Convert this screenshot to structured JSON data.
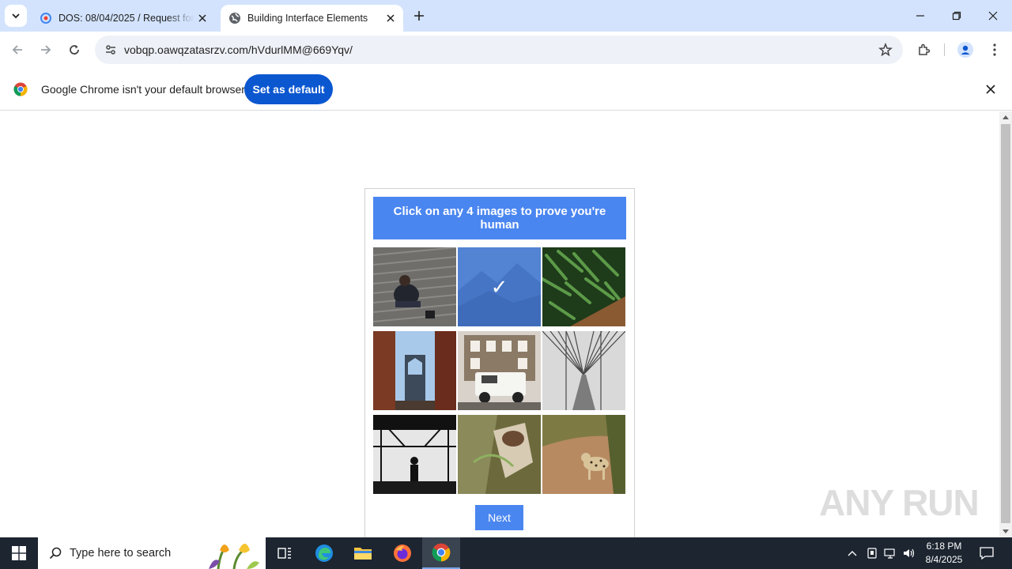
{
  "browser": {
    "tabs": [
      {
        "title": "DOS: 08/04/2025 / Request for",
        "active": false
      },
      {
        "title": "Building Interface Elements",
        "active": true
      }
    ],
    "url": "vobqp.oawqzatasrzv.com/hVdurlMM@669Yqv/"
  },
  "infobar": {
    "message": "Google Chrome isn't your default browser",
    "button_label": "Set as default"
  },
  "captcha": {
    "instruction": "Click on any 4 images to prove you're human",
    "selected_mark": "✓",
    "next_label": "Next",
    "tiles": [
      {
        "name": "person-sitting-on-steps",
        "selected": false
      },
      {
        "name": "mountain-landscape",
        "selected": true
      },
      {
        "name": "green-beans",
        "selected": false
      },
      {
        "name": "bridge-between-buildings",
        "selected": false
      },
      {
        "name": "white-suv-by-building",
        "selected": false
      },
      {
        "name": "suspension-bridge-walkway",
        "selected": false
      },
      {
        "name": "silhouette-under-structure",
        "selected": false
      },
      {
        "name": "person-with-plant",
        "selected": false
      },
      {
        "name": "leopard-on-dirt-road",
        "selected": false
      }
    ]
  },
  "watermark": "ANY RUN",
  "taskbar": {
    "search_placeholder": "Type here to search",
    "time": "6:18 PM",
    "date": "8/4/2025"
  },
  "colors": {
    "tabstrip": "#d3e3fd",
    "primary_button": "#0b57d0",
    "captcha_accent": "#4a86f0",
    "taskbar": "#1c2530"
  }
}
